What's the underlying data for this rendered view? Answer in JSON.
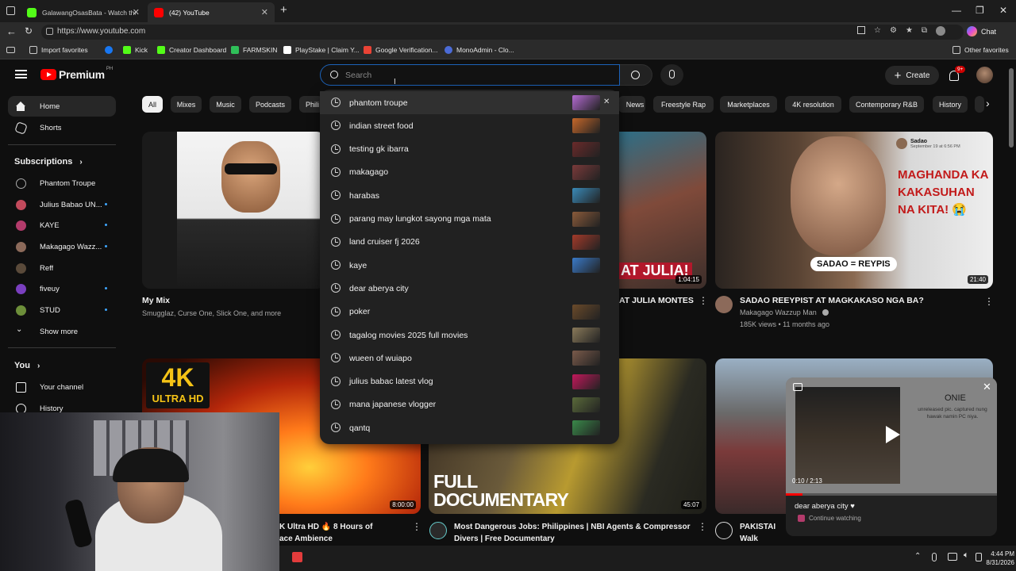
{
  "browser": {
    "tabs": [
      {
        "label": "GalawangOsasBata - Watch the VO",
        "active": false
      },
      {
        "label": "(42) YouTube",
        "active": true
      }
    ],
    "url": "https://www.youtube.com",
    "favorites": [
      "Import favorites",
      "",
      "Kick",
      "Creator Dashboard",
      "FARMSKIN",
      "PlayStake | Claim Y...",
      "Google Verification...",
      "MonoAdmin - Clo..."
    ],
    "other_favorites": "Other favorites",
    "chat_label": "Chat"
  },
  "header": {
    "logo_text": "Premium",
    "logo_region": "PH",
    "search_placeholder": "Search",
    "create_label": "Create",
    "notifications_badge": "9+"
  },
  "sidebar": {
    "top": [
      {
        "label": "Home",
        "icon": "home-icon"
      },
      {
        "label": "Shorts",
        "icon": "shorts-icon"
      }
    ],
    "subscriptions_heading": "Subscriptions",
    "subscriptions": [
      {
        "label": "Phantom Troupe",
        "dot": false
      },
      {
        "label": "Julius Babao UN...",
        "dot": true
      },
      {
        "label": "KAYE",
        "dot": true
      },
      {
        "label": "Makagago Wazz...",
        "dot": true
      },
      {
        "label": "Reff",
        "dot": false
      },
      {
        "label": "fiveuy",
        "dot": true
      },
      {
        "label": "STUD",
        "dot": true
      }
    ],
    "show_more": "Show more",
    "you_heading": "You",
    "you_items": [
      "Your channel",
      "History"
    ]
  },
  "chips": [
    "All",
    "Mixes",
    "Music",
    "Podcasts",
    "Phili",
    "News",
    "Freestyle Rap",
    "Marketplaces",
    "4K resolution",
    "Contemporary R&B",
    "History"
  ],
  "suggestions": [
    "phantom troupe",
    "indian street food",
    "testing gk ibarra",
    "makagago",
    "harabas",
    "parang may lungkot sayong mga mata",
    "land cruiser fj 2026",
    "kaye",
    "dear aberya city",
    "poker",
    "tagalog movies 2025 full movies",
    "wueen of wuiapo",
    "julius babac latest vlog",
    "mana japanese vlogger",
    "qantq"
  ],
  "videos": {
    "v1": {
      "title": "My Mix",
      "meta": "Smugglaz, Curse One, Slick One, and more"
    },
    "v2": {
      "title": "AT JULIA MONTES",
      "duration": "1:04:15",
      "overlay": "AT JULIA!"
    },
    "v3": {
      "title": "SADAO REEYPIST AT MAGKAKASO NGA BA?",
      "channel": "Makagago Wazzup Man",
      "meta": "185K views • 11 months ago",
      "duration": "21:40",
      "overlay_text": "MAGHANDA KA KAKASUHAN NA KITA! 😭",
      "badge": "SADAO = REYPIS",
      "post_name": "Sadao",
      "post_date": "September 19 at 6:56 PM"
    },
    "v4": {
      "title": "K Ultra HD 🔥 8 Hours of",
      "title2": "ace Ambience",
      "duration": "8:00:00",
      "overlay": "4K",
      "overlay2": "ULTRA HD"
    },
    "v5": {
      "title": "Most Dangerous Jobs: Philippines | NBI Agents & Compressor Divers | Free Documentary",
      "duration": "45:07",
      "overlay": "FULL DOCUMENTARY"
    },
    "v6": {
      "title": "PAKISTAI",
      "title2": "Walk"
    }
  },
  "mini_player": {
    "time": "0:10 / 2:13",
    "title": "dear aberya city ♥",
    "continue": "Continue watching",
    "overlay_title": "ONIE",
    "overlay_sub": "unreleased pic. captured nung hawak namin PC niya."
  },
  "taskbar": {
    "time": "4:44 PM",
    "date": "8/31/2026"
  }
}
